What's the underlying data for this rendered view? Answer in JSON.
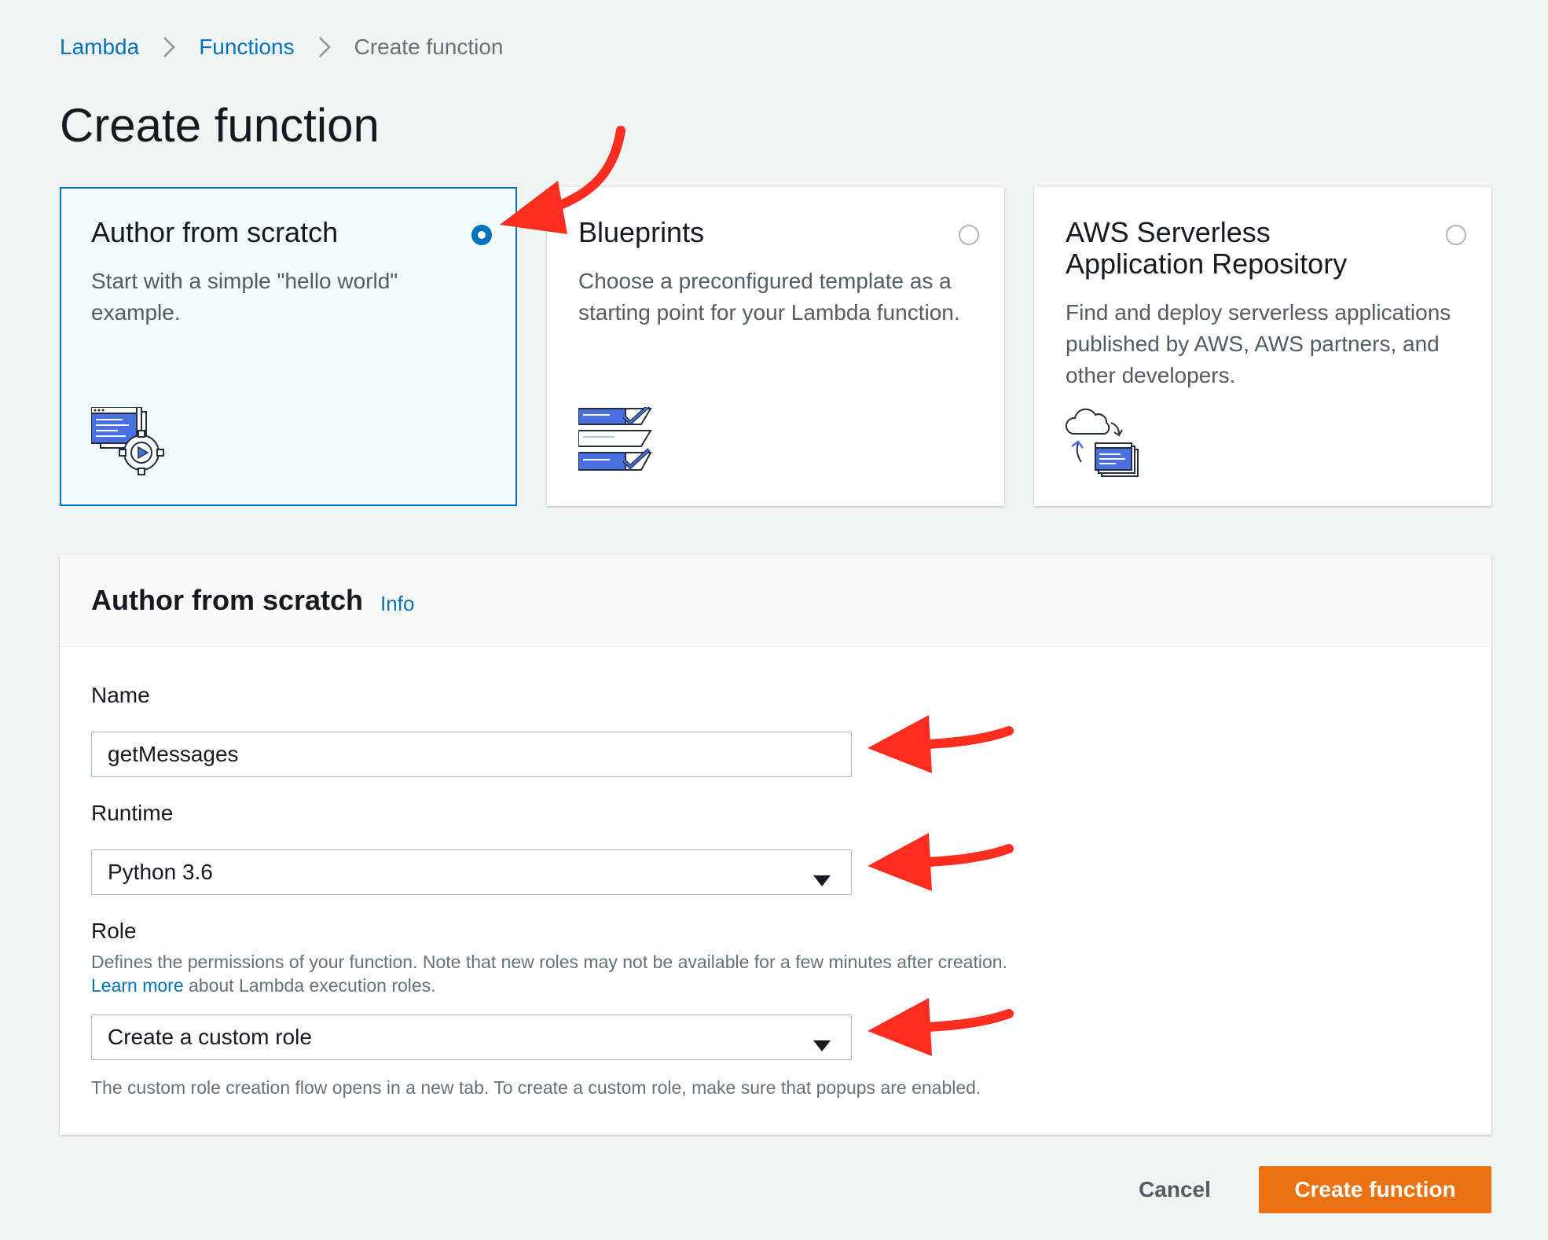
{
  "breadcrumb": {
    "items": [
      {
        "label": "Lambda"
      },
      {
        "label": "Functions"
      },
      {
        "label": "Create function"
      }
    ]
  },
  "page_title": "Create function",
  "options": [
    {
      "title": "Author from scratch",
      "description": "Start with a simple \"hello world\" example.",
      "selected": true,
      "icon": "code-gear-icon"
    },
    {
      "title": "Blueprints",
      "description": "Choose a preconfigured template as a starting point for your Lambda function.",
      "selected": false,
      "icon": "blueprints-checklist-icon"
    },
    {
      "title": "AWS Serverless Application Repository",
      "description": "Find and deploy serverless applications published by AWS, AWS partners, and other developers.",
      "selected": false,
      "icon": "cloud-sync-icon"
    }
  ],
  "form": {
    "title": "Author from scratch",
    "info_label": "Info",
    "name": {
      "label": "Name",
      "value": "getMessages"
    },
    "runtime": {
      "label": "Runtime",
      "value": "Python 3.6"
    },
    "role": {
      "label": "Role",
      "description": "Defines the permissions of your function. Note that new roles may not be available for a few minutes after creation.",
      "learn_more": "Learn more",
      "learn_more_suffix": " about Lambda execution roles.",
      "value": "Create a custom role",
      "note": "The custom role creation flow opens in a new tab. To create a custom role, make sure that popups are enabled."
    }
  },
  "actions": {
    "cancel": "Cancel",
    "create": "Create function"
  },
  "colors": {
    "accent": "#0073bb",
    "primary_button": "#ec7211",
    "annotation_arrow": "#ff2d1f",
    "background": "#f2f3f3"
  }
}
